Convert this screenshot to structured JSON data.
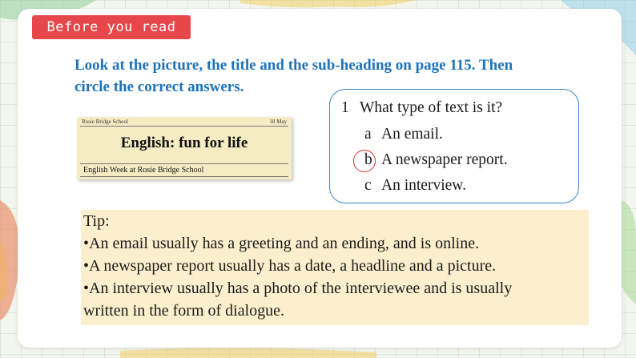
{
  "section_badge": "Before you read",
  "instruction": {
    "line1": "Look at the picture, the title and the sub-heading on page 115. Then",
    "line2": "circle the correct answers."
  },
  "newspaper": {
    "school": "Rosie Bridge School",
    "date": "18 May",
    "headline": "English: fun for life",
    "subheading": "English Week at Rosie Bridge School"
  },
  "question": {
    "number": "1",
    "text": "What type of text is it?",
    "options": [
      {
        "letter": "a",
        "text": "An email."
      },
      {
        "letter": "b",
        "text": "A newspaper report."
      },
      {
        "letter": "c",
        "text": "An interview."
      }
    ],
    "selected": "b"
  },
  "tip": {
    "lines": [
      "Tip:",
      "•An email usually has a greeting and an ending, and is online.",
      "•A newspaper report usually has a date, a headline and a picture.",
      "•An interview usually has a photo of the interviewee and is usually",
      "written in the form of dialogue."
    ]
  },
  "colors": {
    "badge": "#e5474a",
    "instruction_text": "#1e73b8",
    "question_border": "#3d86c6",
    "circle": "#d9302c",
    "tip_background": "#fbefcd",
    "paper_background": "#f6ecc4"
  }
}
